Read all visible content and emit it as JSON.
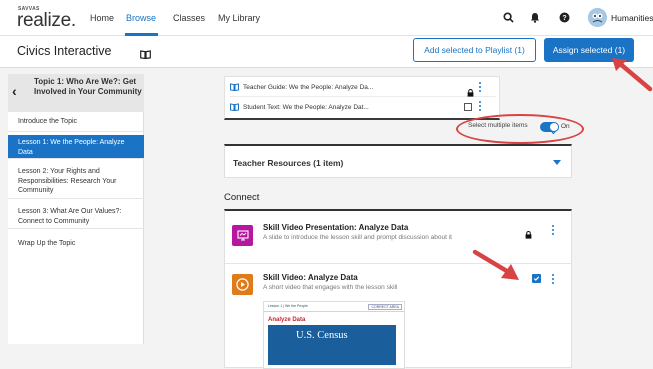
{
  "nav": {
    "logo_top": "SAVVAS",
    "logo_main": "realize.",
    "links": [
      "Home",
      "Browse",
      "Classes",
      "My Library"
    ],
    "user": "Humanities"
  },
  "colors": {
    "accent": "#1a73c5",
    "callout": "#d84343",
    "skill_presentation": "#b5179e",
    "skill_video": "#e07b19"
  },
  "subheader": {
    "title": "Civics Interactive",
    "add_playlist": "Add selected to Playlist (1)",
    "assign": "Assign selected (1)"
  },
  "sidebar": {
    "topic_title": "Topic 1: Who Are We?: Get Involved in Your Community",
    "items": [
      "Introduce the Topic",
      "Lesson 1: We the People: Analyze Data",
      "Lesson 2: Your Rights and Responsibilities: Research Your Community",
      "Lesson 3: What Are Our Values?: Connect to Community",
      "Wrap Up the Topic"
    ],
    "active_index": 1
  },
  "resources": [
    {
      "label": "Teacher Guide: We the People: Analyze Da...",
      "locked": true
    },
    {
      "label": "Student Text: We the People: Analyze Dat...",
      "locked": false
    }
  ],
  "select_multiple": {
    "label": "Select multiple items",
    "state": "On"
  },
  "accordion": {
    "label": "Teacher Resources (1 item)"
  },
  "section": "Connect",
  "items": [
    {
      "title": "Skill Video Presentation: Analyze Data",
      "desc": "A slide to introduce the lesson skill and prompt discussion about it",
      "icon": "presentation-icon"
    },
    {
      "title": "Skill Video: Analyze Data",
      "desc": "A short video that engages with the lesson skill",
      "icon": "play-icon"
    }
  ],
  "thumbnail": {
    "head_left": "Lesson 1 | We the People",
    "head_right": "CORRECT AREA",
    "red_title": "Analyze Data",
    "banner": "U.S. Census"
  }
}
